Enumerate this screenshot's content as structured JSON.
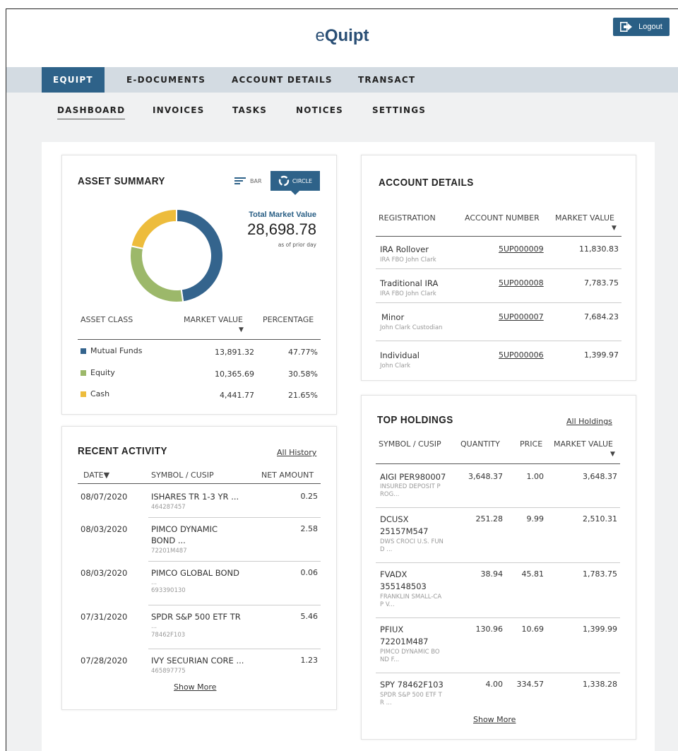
{
  "header": {
    "brand_prefix": "e",
    "brand_bold": "Quipt",
    "logout_label": "Logout"
  },
  "nav_primary": [
    {
      "label": "EQUIPT",
      "active": true
    },
    {
      "label": "E-DOCUMENTS",
      "active": false
    },
    {
      "label": "ACCOUNT DETAILS",
      "active": false
    },
    {
      "label": "TRANSACT",
      "active": false
    }
  ],
  "nav_secondary": [
    {
      "label": "DASHBOARD",
      "active": true
    },
    {
      "label": "INVOICES",
      "active": false
    },
    {
      "label": "TASKS",
      "active": false
    },
    {
      "label": "NOTICES",
      "active": false
    },
    {
      "label": "SETTINGS",
      "active": false
    }
  ],
  "asset_summary": {
    "title": "ASSET SUMMARY",
    "toggle_bar": "BAR",
    "toggle_circle": "CIRCLE",
    "total_label": "Total Market Value",
    "total_value": "28,698.78",
    "total_note": "as of prior day",
    "headers": {
      "asset_class": "ASSET CLASS",
      "market_value": "MARKET VALUE",
      "percentage": "PERCENTAGE",
      "sort": "▼"
    },
    "rows": [
      {
        "name": "Mutual Funds",
        "value": "13,891.32",
        "pct": "47.77%",
        "color": "#34648d"
      },
      {
        "name": "Equity",
        "value": "10,365.69",
        "pct": "30.58%",
        "color": "#9cb86a"
      },
      {
        "name": "Cash",
        "value": "4,441.77",
        "pct": "21.65%",
        "color": "#edbc3c"
      }
    ]
  },
  "chart_data": {
    "type": "pie",
    "categories": [
      "Mutual Funds",
      "Equity",
      "Cash"
    ],
    "values": [
      47.77,
      30.58,
      21.65
    ],
    "colors": [
      "#34648d",
      "#9cb86a",
      "#edbc3c"
    ],
    "title": "",
    "donut": true
  },
  "account_details": {
    "title": "ACCOUNT DETAILS",
    "headers": {
      "registration": "REGISTRATION",
      "account_number": "ACCOUNT NUMBER",
      "market_value": "MARKET VALUE",
      "sort": "▼"
    },
    "rows": [
      {
        "reg": "IRA Rollover",
        "sub": "IRA FBO John Clark",
        "acct": "5UP000009",
        "value": "11,830.83"
      },
      {
        "reg": "Traditional IRA",
        "sub": "IRA FBO John Clark",
        "acct": "5UP000008",
        "value": "7,783.75"
      },
      {
        "reg": "Minor",
        "sub": "John Clark Custodian",
        "acct": "5UP000007",
        "value": "7,684.23"
      },
      {
        "reg": "Individual",
        "sub": "John Clark",
        "acct": "5UP000006",
        "value": "1,399.97"
      }
    ]
  },
  "recent_activity": {
    "title": "RECENT ACTIVITY",
    "link": "All History",
    "headers": {
      "date": "DATE▼",
      "symbol": "SYMBOL / CUSIP",
      "amount": "NET AMOUNT"
    },
    "rows": [
      {
        "date": "08/07/2020",
        "l1": "ISHARES TR 1-3 YR ...",
        "l2": "",
        "cusip": "464287457",
        "amount": "0.25"
      },
      {
        "date": "08/03/2020",
        "l1": "PIMCO DYNAMIC",
        "l2": "BOND ...",
        "cusip": "72201M487",
        "amount": "2.58"
      },
      {
        "date": "08/03/2020",
        "l1": "PIMCO GLOBAL BOND",
        "l2": "...",
        "cusip": "693390130",
        "amount": "0.06"
      },
      {
        "date": "07/31/2020",
        "l1": "SPDR S&P 500 ETF TR",
        "l2": "...",
        "cusip": "78462F103",
        "amount": "5.46"
      },
      {
        "date": "07/28/2020",
        "l1": "IVY SECURIAN CORE ...",
        "l2": "",
        "cusip": "465897775",
        "amount": "1.23"
      }
    ],
    "show_more": "Show More"
  },
  "top_holdings": {
    "title": "TOP HOLDINGS",
    "link": "All Holdings",
    "headers": {
      "symbol": "SYMBOL / CUSIP",
      "quantity": "QUANTITY",
      "price": "PRICE",
      "market_value": "MARKET VALUE",
      "sort": "▼"
    },
    "rows": [
      {
        "l1": "AIGI PER980007",
        "l2": "",
        "s1": "INSURED DEPOSIT P",
        "s2": "ROG...",
        "qty": "3,648.37",
        "price": "1.00",
        "value": "3,648.37"
      },
      {
        "l1": "DCUSX",
        "l2": "25157M547",
        "s1": "DWS CROCI U.S. FUN",
        "s2": "D ...",
        "qty": "251.28",
        "price": "9.99",
        "value": "2,510.31"
      },
      {
        "l1": "FVADX",
        "l2": "355148503",
        "s1": "FRANKLIN SMALL-CA",
        "s2": "P V...",
        "qty": "38.94",
        "price": "45.81",
        "value": "1,783.75"
      },
      {
        "l1": "PFIUX",
        "l2": "72201M487",
        "s1": "PIMCO DYNAMIC BO",
        "s2": "ND F...",
        "qty": "130.96",
        "price": "10.69",
        "value": "1,399.99"
      },
      {
        "l1": "SPY 78462F103",
        "l2": "",
        "s1": "SPDR S&P 500 ETF T",
        "s2": "R ...",
        "qty": "4.00",
        "price": "334.57",
        "value": "1,338.28"
      }
    ],
    "show_more": "Show More"
  }
}
